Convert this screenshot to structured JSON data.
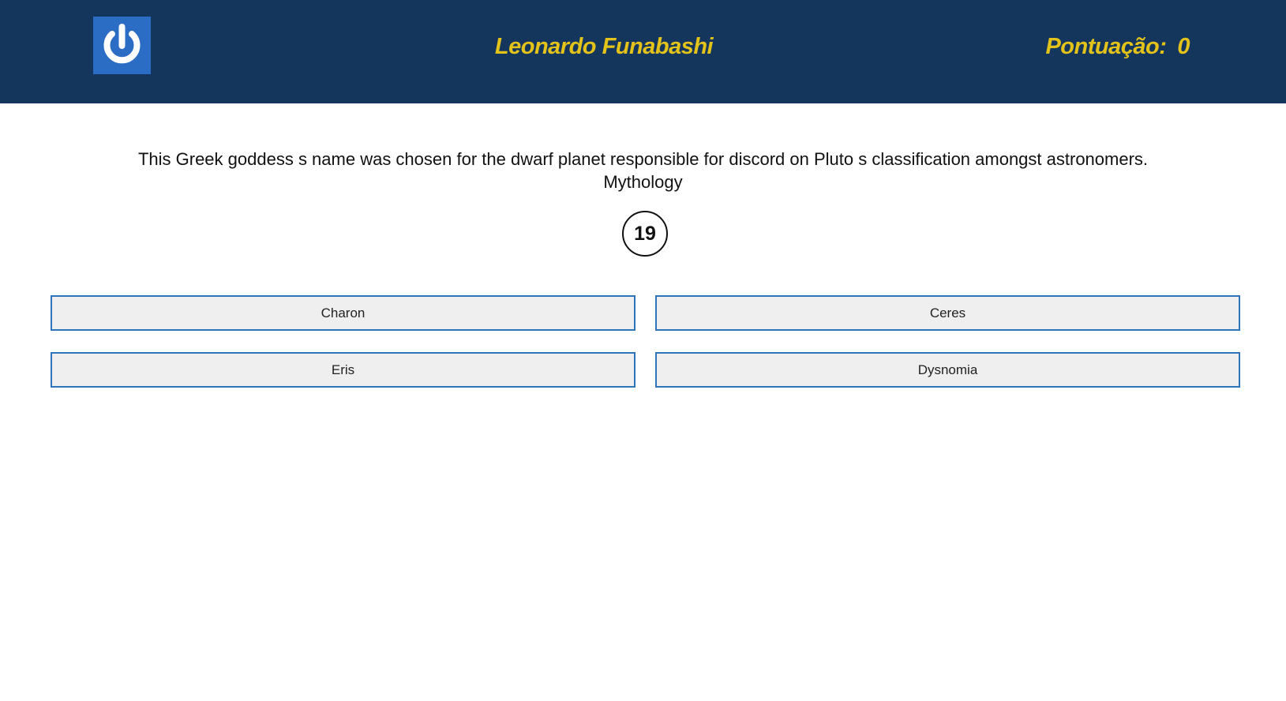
{
  "header": {
    "logout_icon": "power-icon",
    "player_name": "Leonardo Funabashi",
    "score_label": "Pontuação:",
    "score_value": "0"
  },
  "question": {
    "text": "This Greek goddess s name was chosen for the dwarf planet responsible for discord on Pluto s classification amongst astronomers.",
    "category": "Mythology",
    "timer": "19"
  },
  "answers": [
    {
      "label": "Charon"
    },
    {
      "label": "Ceres"
    },
    {
      "label": "Eris"
    },
    {
      "label": "Dysnomia"
    }
  ],
  "colors": {
    "header_bg": "#14365d",
    "accent_text": "#e3c21a",
    "logout_bg": "#2b6cc4",
    "answer_border": "#2e74b8",
    "answer_bg": "#efefef"
  }
}
